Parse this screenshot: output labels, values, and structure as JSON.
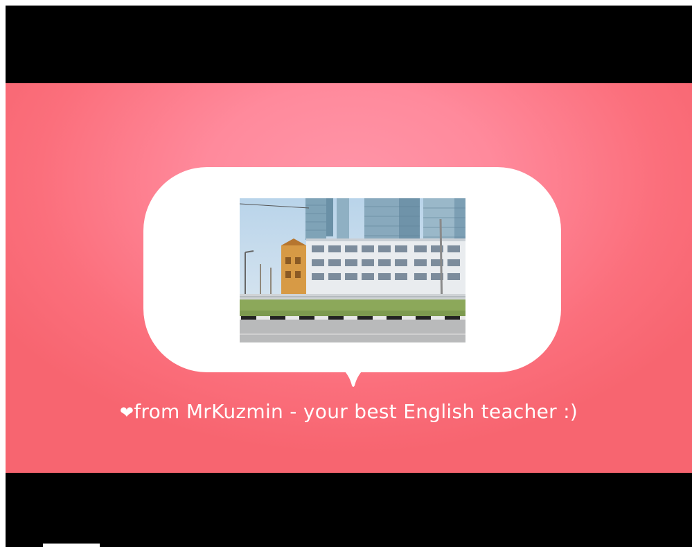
{
  "video": {
    "caption": {
      "heart_symbol": "❤",
      "text": "from MrKuzmin - your best English teacher :)"
    },
    "photo_icon": "photo-of-school-building"
  },
  "colors": {
    "letterbox": "#000000",
    "slide_background": "#fb7080",
    "bubble": "#ffffff",
    "caption_text": "#ffffff"
  }
}
